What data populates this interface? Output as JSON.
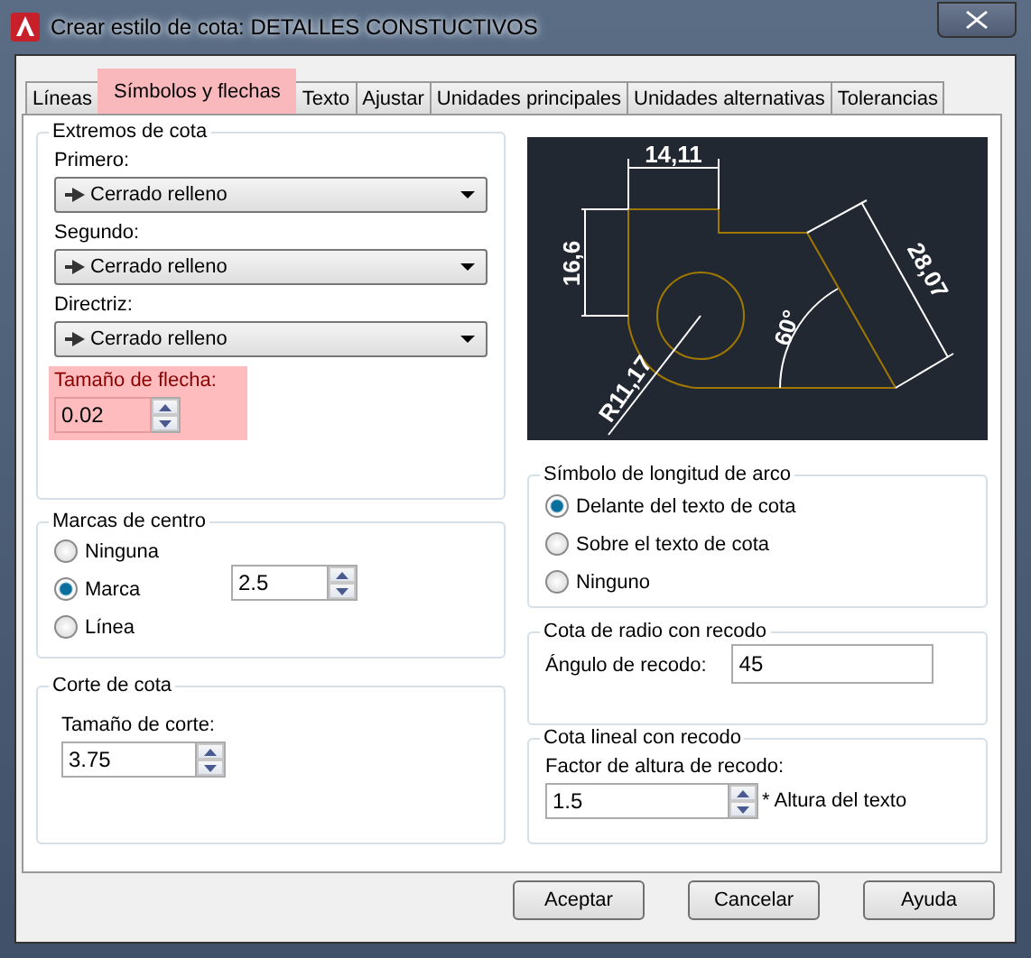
{
  "window": {
    "title": "Crear estilo de cota: DETALLES CONSTUCTIVOS"
  },
  "tabs": [
    {
      "label": "Líneas",
      "selected": false,
      "highlighted": false
    },
    {
      "label": "Símbolos y flechas",
      "selected": true,
      "highlighted": true
    },
    {
      "label": "Texto",
      "selected": false,
      "highlighted": false
    },
    {
      "label": "Ajustar",
      "selected": false,
      "highlighted": false
    },
    {
      "label": "Unidades principales",
      "selected": false,
      "highlighted": false
    },
    {
      "label": "Unidades alternativas",
      "selected": false,
      "highlighted": false
    },
    {
      "label": "Tolerancias",
      "selected": false,
      "highlighted": false
    }
  ],
  "arrowheads": {
    "title": "Extremos de cota",
    "fields": [
      {
        "label": "Primero:",
        "value": "Cerrado relleno"
      },
      {
        "label": "Segundo:",
        "value": "Cerrado relleno"
      },
      {
        "label": "Directriz:",
        "value": "Cerrado relleno"
      }
    ],
    "arrow_size": {
      "label": "Tamaño de flecha:",
      "value": "0.02",
      "highlighted": true
    }
  },
  "center_marks": {
    "title": "Marcas de centro",
    "options": [
      {
        "label": "Ninguna",
        "selected": false
      },
      {
        "label": "Marca",
        "selected": true
      },
      {
        "label": "Línea",
        "selected": false
      }
    ],
    "size": "2.5"
  },
  "dimension_break": {
    "title": "Corte de cota",
    "label": "Tamaño de corte:",
    "value": "3.75"
  },
  "preview": {
    "labels": [
      "14,11",
      "16,6",
      "28,07",
      "60°",
      "R11,17"
    ]
  },
  "arc_length_symbol": {
    "title": "Símbolo de longitud de arco",
    "options": [
      {
        "label": "Delante del texto de cota",
        "selected": true
      },
      {
        "label": "Sobre el texto de cota",
        "selected": false
      },
      {
        "label": "Ninguno",
        "selected": false
      }
    ]
  },
  "radius_jog": {
    "title": "Cota de radio con recodo",
    "label": "Ángulo de recodo:",
    "value": "45"
  },
  "linear_jog": {
    "title": "Cota lineal con recodo",
    "label": "Factor de altura de recodo:",
    "value": "1.5",
    "suffix": "* Altura del texto"
  },
  "buttons": [
    "Aceptar",
    "Cancelar",
    "Ayuda"
  ]
}
